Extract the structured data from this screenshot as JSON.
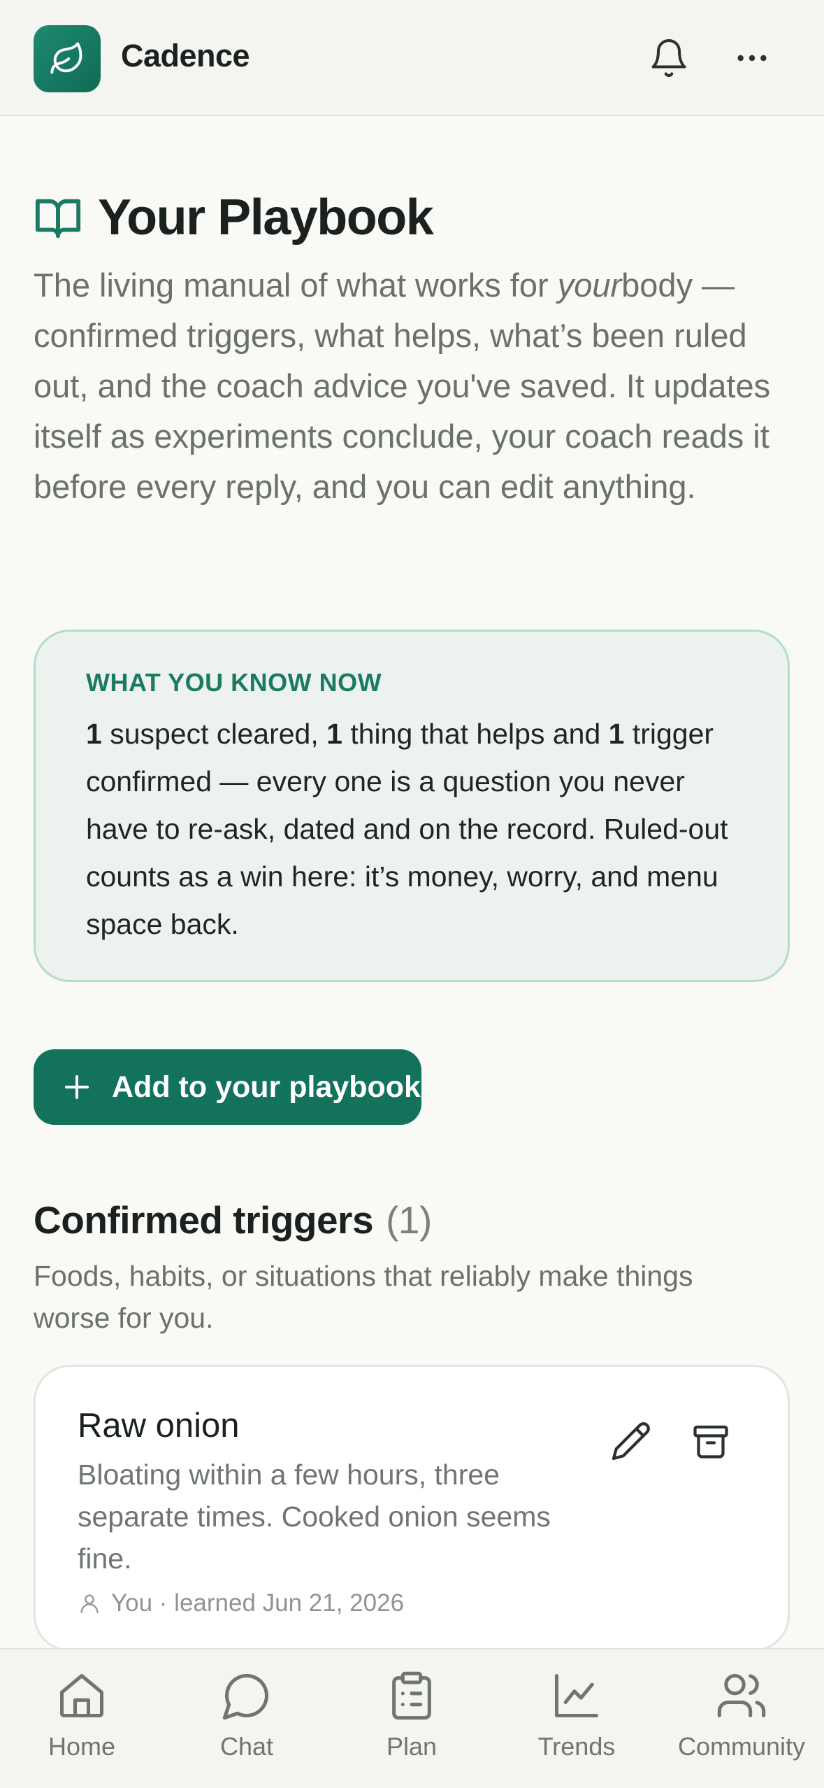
{
  "app": {
    "name": "Cadence"
  },
  "page": {
    "title": "Your Playbook",
    "intro_before": "The living manual of what works for ",
    "intro_em": "your",
    "intro_after": "body — confirmed triggers, what helps, what’s been ruled out, and the coach advice you've saved. It updates itself as experiments conclude, your coach reads it before every reply, and you can edit anything."
  },
  "know_card": {
    "label": "WHAT YOU KNOW NOW",
    "n1": "1",
    "t1": " suspect cleared, ",
    "n2": "1",
    "t2": " thing that helps and ",
    "n3": "1",
    "t3": " trigger confirmed — every one is a question you never have to re-ask, dated and on the record. Ruled-out counts as a win here: it’s money, worry, and menu space back."
  },
  "add_button": {
    "label": "Add to your playbook"
  },
  "confirmed_triggers": {
    "title": "Confirmed triggers",
    "count": "(1)",
    "description": "Foods, habits, or situations that reliably make things worse for you.",
    "items": [
      {
        "name": "Raw onion",
        "description": "Bloating within a few hours, three separate times. Cooked onion seems fine.",
        "meta": "You · learned Jun 21, 2026"
      }
    ]
  },
  "nav": [
    {
      "label": "Home",
      "icon": "home-icon"
    },
    {
      "label": "Chat",
      "icon": "chat-icon"
    },
    {
      "label": "Plan",
      "icon": "clipboard-icon"
    },
    {
      "label": "Trends",
      "icon": "chart-icon"
    },
    {
      "label": "Community",
      "icon": "users-icon"
    }
  ],
  "colors": {
    "brand": "#12725b",
    "accent_text": "#1a7a63",
    "card_border": "#b4dccd"
  }
}
